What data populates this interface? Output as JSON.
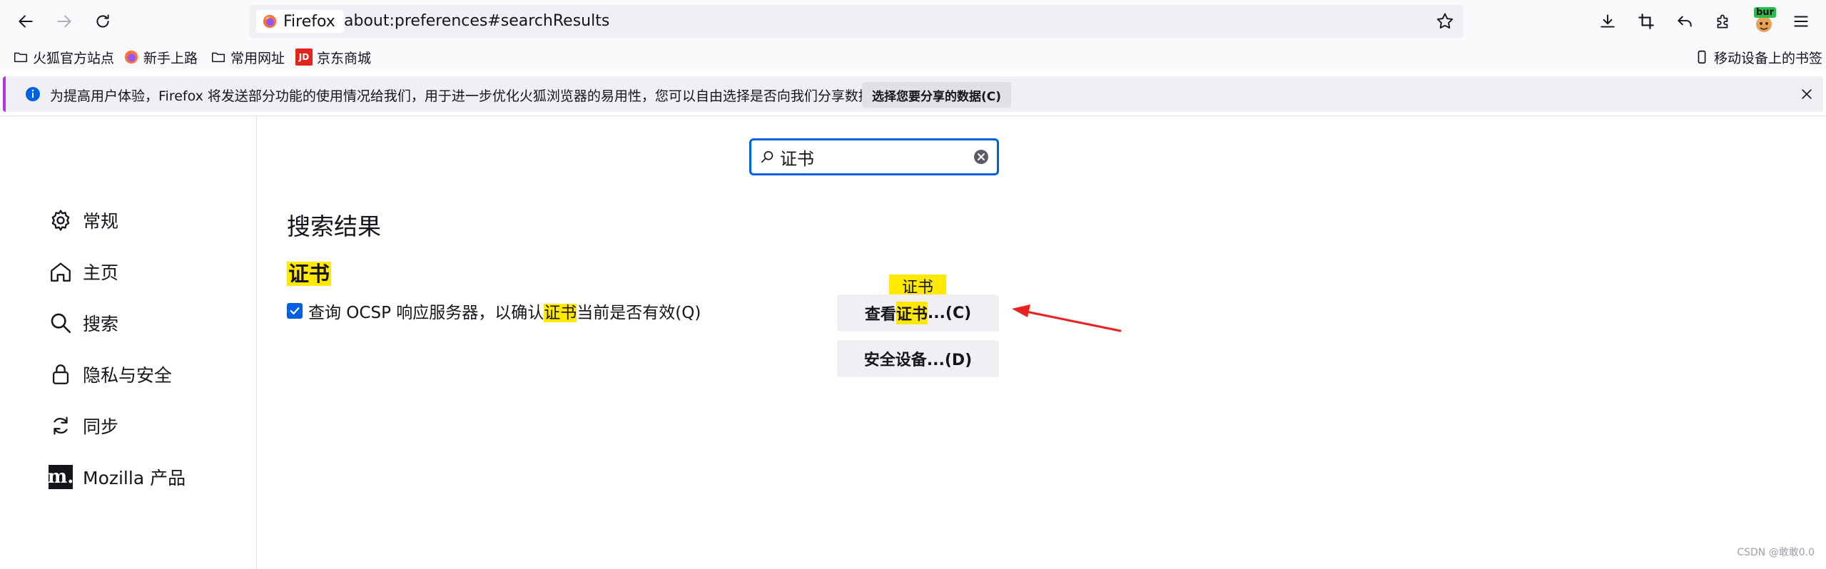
{
  "toolbar": {
    "identity_label": "Firefox",
    "url": "about:preferences#searchResults",
    "avatar_badge": "bur"
  },
  "bookmarks": [
    {
      "label": "火狐官方站点",
      "icon": "folder-icon"
    },
    {
      "label": "新手上路",
      "icon": "firefox-icon"
    },
    {
      "label": "常用网址",
      "icon": "folder-icon"
    },
    {
      "label": "京东商城",
      "icon": "jd-icon",
      "icon_text": "JD"
    }
  ],
  "mobile_bookmarks": "移动设备上的书签",
  "notification": {
    "text": "为提高用户体验，Firefox 将发送部分功能的使用情况给我们，用于进一步优化火狐浏览器的易用性，您可以自由选择是否向我们分享数据。",
    "button": "选择您要分享的数据(C)"
  },
  "sidebar": {
    "items": [
      {
        "label": "常规",
        "icon": "gear-icon"
      },
      {
        "label": "主页",
        "icon": "home-icon"
      },
      {
        "label": "搜索",
        "icon": "search-icon"
      },
      {
        "label": "隐私与安全",
        "icon": "lock-icon"
      },
      {
        "label": "同步",
        "icon": "sync-icon"
      },
      {
        "label": "Mozilla 产品",
        "icon": "mozilla-icon",
        "icon_text": "m."
      }
    ]
  },
  "search": {
    "value": "证书"
  },
  "main": {
    "results_title": "搜索结果",
    "section_title": "证书",
    "ocsp": {
      "checked": true,
      "before": "查询 OCSP 响应服务器，以确认",
      "highlight": "证书",
      "after": "当前是否有效(Q)"
    },
    "tooltip": "证书",
    "view_cert": {
      "before": "查看",
      "highlight": "证书",
      "after": "...(C)"
    },
    "security_devices": "安全设备...(D)"
  },
  "colors": {
    "accent": "#0061e0",
    "highlight": "#ffe900",
    "annotation_arrow": "#e8231f"
  },
  "watermark": "CSDN @敢敢0.0"
}
